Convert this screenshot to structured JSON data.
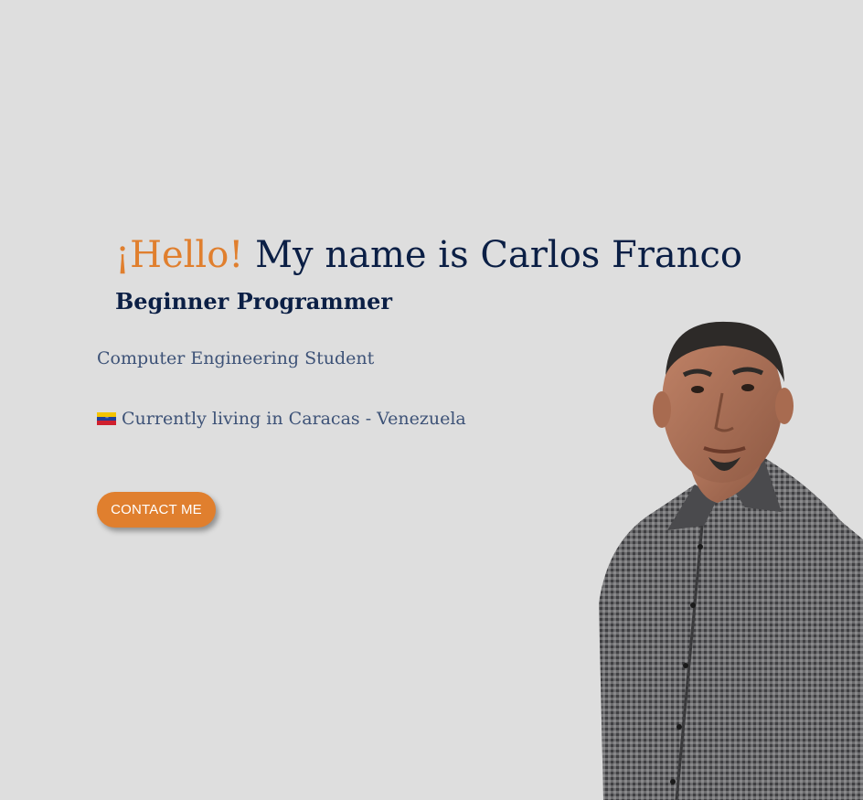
{
  "hero": {
    "greeting": "¡Hello!",
    "name_line": "My name is Carlos Franco",
    "subtitle": "Beginner Programmer",
    "study": "Computer Engineering Student",
    "location": "Currently living in Caracas - Venezuela",
    "flag_icon": "venezuela-flag-icon",
    "contact_button": "CONTACT ME"
  },
  "colors": {
    "background": "#dedede",
    "accent": "#e07f2e",
    "heading": "#0b1f45",
    "body_text": "#3d5277"
  }
}
